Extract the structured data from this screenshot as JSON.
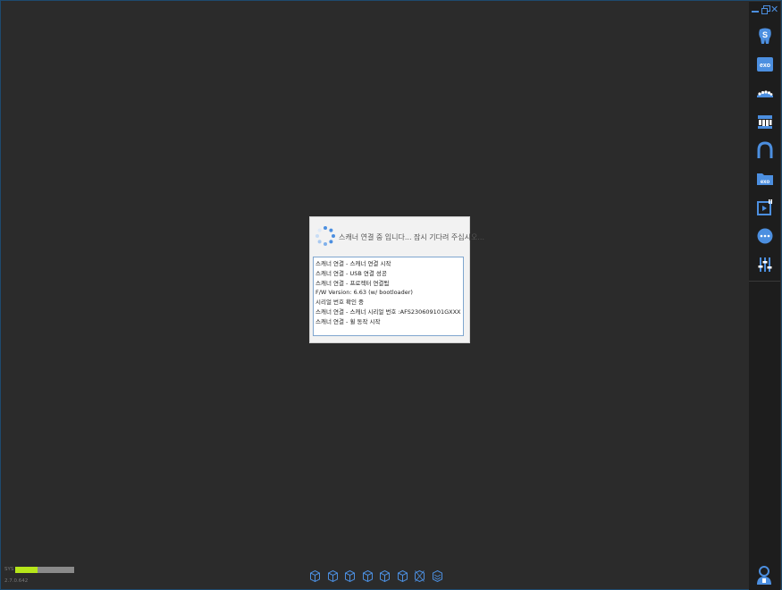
{
  "dialog": {
    "message": "스캐너 연결 중 입니다... 잠시 기다려 주십시오...",
    "log": [
      "스캐너 연결 - 스캐너 연결 시작",
      "스캐너 연결 - USB 연결 성공",
      "스캐너 연결 - 프로젝터 연결됨",
      "F/W Version: 6.63 (w/ bootloader)",
      "시리얼 번호 확인 중",
      "스캐너 연결 - 스캐너 시리얼 번호 :AFS230609101GXXX",
      "스캐너 연결 - 휠 동작 시작"
    ]
  },
  "status": {
    "sys_label": "SYS",
    "sys_usage": 0.38,
    "version": "2.7.0.642"
  },
  "sidebar": {
    "tools": [
      {
        "name": "tooth-s-icon",
        "label": "S"
      },
      {
        "name": "exo-icon",
        "label": "exo"
      },
      {
        "name": "lower-jaw-icon"
      },
      {
        "name": "upper-jaw-icon"
      },
      {
        "name": "arch-icon"
      },
      {
        "name": "exo-folder-icon",
        "label": "exo"
      },
      {
        "name": "video-icon"
      },
      {
        "name": "options-icon"
      },
      {
        "name": "sliders-icon"
      }
    ]
  },
  "colors": {
    "accent": "#4c8fe0",
    "background": "#2b2b2b",
    "sidebar": "#1d1d1d",
    "usage_fill": "#b6e61a"
  }
}
